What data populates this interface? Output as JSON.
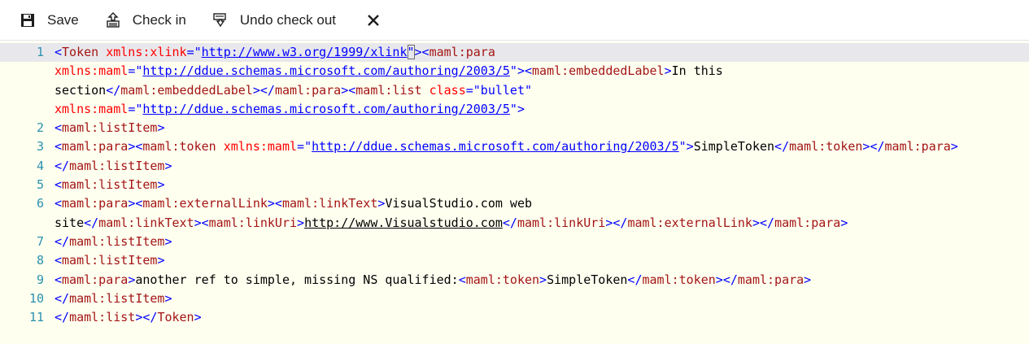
{
  "toolbar": {
    "save_label": "Save",
    "checkin_label": "Check in",
    "undo_checkout_label": "Undo check out",
    "icons": {
      "save": "floppy-disk-icon",
      "checkin": "check-in-icon",
      "undo_checkout": "undo-checkout-icon",
      "close": "close-icon"
    }
  },
  "editor": {
    "colors": {
      "background": "#fffff0",
      "line_number": "#2b91af",
      "element": "#a31515",
      "bracket": "#0000ff",
      "attribute": "#ff0000",
      "attribute_value": "#0000ff",
      "current_line": "#e8e8ec"
    },
    "visual_lines": [
      {
        "num": "1",
        "current": true,
        "tokens": [
          {
            "c": "br",
            "t": "<"
          },
          {
            "c": "el",
            "t": "Token"
          },
          {
            "c": "tx",
            "t": " "
          },
          {
            "c": "an",
            "t": "xmlns:xlink"
          },
          {
            "c": "br",
            "t": "="
          },
          {
            "c": "av",
            "t": "\""
          },
          {
            "c": "link",
            "t": "http://www.w3.org/1999/xlink"
          },
          {
            "c": "av",
            "t": "\"",
            "box": true
          },
          {
            "c": "br",
            "t": "><"
          },
          {
            "c": "el",
            "t": "maml:para"
          }
        ]
      },
      {
        "num": "",
        "tokens": [
          {
            "c": "an",
            "t": "xmlns:maml"
          },
          {
            "c": "br",
            "t": "="
          },
          {
            "c": "av",
            "t": "\""
          },
          {
            "c": "link",
            "t": "http://ddue.schemas.microsoft.com/authoring/2003/5"
          },
          {
            "c": "av",
            "t": "\""
          },
          {
            "c": "br",
            "t": "><"
          },
          {
            "c": "el",
            "t": "maml:embeddedLabel"
          },
          {
            "c": "br",
            "t": ">"
          },
          {
            "c": "tx",
            "t": "In this"
          }
        ]
      },
      {
        "num": "",
        "tokens": [
          {
            "c": "tx",
            "t": "section"
          },
          {
            "c": "br",
            "t": "</"
          },
          {
            "c": "el",
            "t": "maml:embeddedLabel"
          },
          {
            "c": "br",
            "t": "></"
          },
          {
            "c": "el",
            "t": "maml:para"
          },
          {
            "c": "br",
            "t": "><"
          },
          {
            "c": "el",
            "t": "maml:list"
          },
          {
            "c": "tx",
            "t": " "
          },
          {
            "c": "an",
            "t": "class"
          },
          {
            "c": "br",
            "t": "="
          },
          {
            "c": "av",
            "t": "\"bullet\""
          }
        ]
      },
      {
        "num": "",
        "tokens": [
          {
            "c": "an",
            "t": "xmlns:maml"
          },
          {
            "c": "br",
            "t": "="
          },
          {
            "c": "av",
            "t": "\""
          },
          {
            "c": "link",
            "t": "http://ddue.schemas.microsoft.com/authoring/2003/5"
          },
          {
            "c": "av",
            "t": "\""
          },
          {
            "c": "br",
            "t": ">"
          }
        ]
      },
      {
        "num": "2",
        "tokens": [
          {
            "c": "br",
            "t": "<"
          },
          {
            "c": "el",
            "t": "maml:listItem"
          },
          {
            "c": "br",
            "t": ">"
          }
        ]
      },
      {
        "num": "3",
        "tokens": [
          {
            "c": "br",
            "t": "<"
          },
          {
            "c": "el",
            "t": "maml:para"
          },
          {
            "c": "br",
            "t": "><"
          },
          {
            "c": "el",
            "t": "maml:token"
          },
          {
            "c": "tx",
            "t": " "
          },
          {
            "c": "an",
            "t": "xmlns:maml"
          },
          {
            "c": "br",
            "t": "="
          },
          {
            "c": "av",
            "t": "\""
          },
          {
            "c": "link",
            "t": "http://ddue.schemas.microsoft.com/authoring/2003/5"
          },
          {
            "c": "av",
            "t": "\""
          },
          {
            "c": "br",
            "t": ">"
          },
          {
            "c": "tx",
            "t": "SimpleToken"
          },
          {
            "c": "br",
            "t": "</"
          },
          {
            "c": "el",
            "t": "maml:token"
          },
          {
            "c": "br",
            "t": "></"
          },
          {
            "c": "el",
            "t": "maml:para"
          },
          {
            "c": "br",
            "t": ">"
          }
        ]
      },
      {
        "num": "4",
        "tokens": [
          {
            "c": "br",
            "t": "</"
          },
          {
            "c": "el",
            "t": "maml:listItem"
          },
          {
            "c": "br",
            "t": ">"
          }
        ]
      },
      {
        "num": "5",
        "tokens": [
          {
            "c": "br",
            "t": "<"
          },
          {
            "c": "el",
            "t": "maml:listItem"
          },
          {
            "c": "br",
            "t": ">"
          }
        ]
      },
      {
        "num": "6",
        "tokens": [
          {
            "c": "br",
            "t": "<"
          },
          {
            "c": "el",
            "t": "maml:para"
          },
          {
            "c": "br",
            "t": "><"
          },
          {
            "c": "el",
            "t": "maml:externalLink"
          },
          {
            "c": "br",
            "t": "><"
          },
          {
            "c": "el",
            "t": "maml:linkText"
          },
          {
            "c": "br",
            "t": ">"
          },
          {
            "c": "tx",
            "t": "VisualStudio.com web"
          }
        ]
      },
      {
        "num": "",
        "tokens": [
          {
            "c": "tx",
            "t": "site"
          },
          {
            "c": "br",
            "t": "</"
          },
          {
            "c": "el",
            "t": "maml:linkText"
          },
          {
            "c": "br",
            "t": "><"
          },
          {
            "c": "el",
            "t": "maml:linkUri"
          },
          {
            "c": "br",
            "t": ">"
          },
          {
            "c": "txu",
            "t": "http://www.Visualstudio.com"
          },
          {
            "c": "br",
            "t": "</"
          },
          {
            "c": "el",
            "t": "maml:linkUri"
          },
          {
            "c": "br",
            "t": "></"
          },
          {
            "c": "el",
            "t": "maml:externalLink"
          },
          {
            "c": "br",
            "t": "></"
          },
          {
            "c": "el",
            "t": "maml:para"
          },
          {
            "c": "br",
            "t": ">"
          }
        ]
      },
      {
        "num": "7",
        "tokens": [
          {
            "c": "br",
            "t": "</"
          },
          {
            "c": "el",
            "t": "maml:listItem"
          },
          {
            "c": "br",
            "t": ">"
          }
        ]
      },
      {
        "num": "8",
        "tokens": [
          {
            "c": "br",
            "t": "<"
          },
          {
            "c": "el",
            "t": "maml:listItem"
          },
          {
            "c": "br",
            "t": ">"
          }
        ]
      },
      {
        "num": "9",
        "tokens": [
          {
            "c": "br",
            "t": "<"
          },
          {
            "c": "el",
            "t": "maml:para"
          },
          {
            "c": "br",
            "t": ">"
          },
          {
            "c": "tx",
            "t": "another ref to simple, missing NS qualified:"
          },
          {
            "c": "br",
            "t": "<"
          },
          {
            "c": "el",
            "t": "maml:token"
          },
          {
            "c": "br",
            "t": ">"
          },
          {
            "c": "tx",
            "t": "SimpleToken"
          },
          {
            "c": "br",
            "t": "</"
          },
          {
            "c": "el",
            "t": "maml:token"
          },
          {
            "c": "br",
            "t": "></"
          },
          {
            "c": "el",
            "t": "maml:para"
          },
          {
            "c": "br",
            "t": ">"
          }
        ]
      },
      {
        "num": "10",
        "tokens": [
          {
            "c": "br",
            "t": "</"
          },
          {
            "c": "el",
            "t": "maml:listItem"
          },
          {
            "c": "br",
            "t": ">"
          }
        ]
      },
      {
        "num": "11",
        "tokens": [
          {
            "c": "br",
            "t": "</"
          },
          {
            "c": "el",
            "t": "maml:list"
          },
          {
            "c": "br",
            "t": "></"
          },
          {
            "c": "el",
            "t": "Token"
          },
          {
            "c": "br",
            "t": ">"
          }
        ]
      }
    ]
  }
}
